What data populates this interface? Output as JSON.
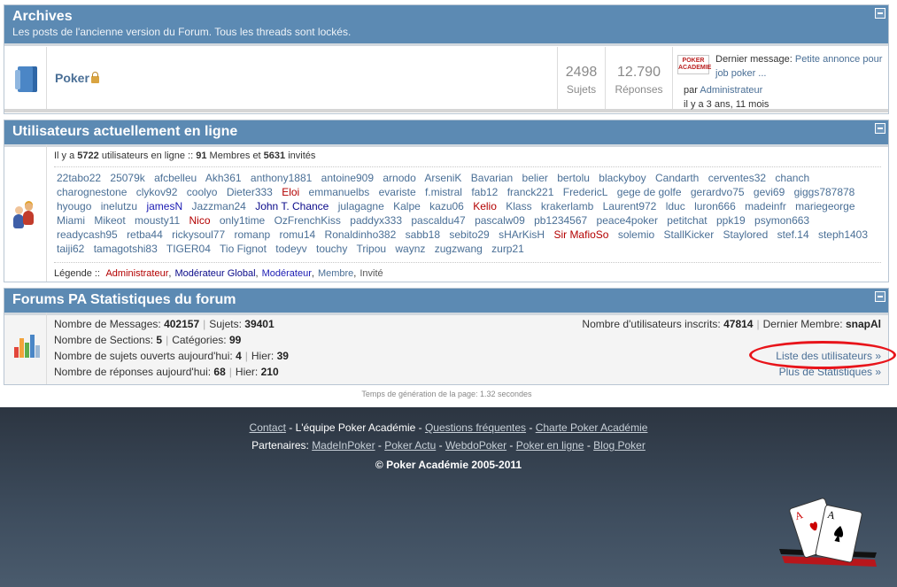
{
  "archives": {
    "title": "Archives",
    "subtitle": "Les posts de l'ancienne version du Forum. Tous les threads sont lockés.",
    "forum_name": "Poker",
    "topics_count": "2498",
    "topics_label": "Sujets",
    "replies_count": "12.790",
    "replies_label": "Réponses",
    "last_message_prefix": "Dernier message:",
    "last_message_title_1": "Petite annonce pour",
    "last_message_title_2": "job poker ...",
    "by_prefix": "par",
    "by_user": "Administrateur",
    "when": "il y a 3 ans, 11 mois",
    "logo_text": "POKER ACADEMIE"
  },
  "online": {
    "title": "Utilisateurs actuellement en ligne",
    "summary_1": "Il y a ",
    "total": "5722",
    "summary_2": " utilisateurs en ligne  ::  ",
    "members": "91",
    "summary_3": " Membres et ",
    "guests": "5631",
    "summary_4": " invités",
    "users": [
      {
        "n": "22tabo22",
        "r": "member"
      },
      {
        "n": "25079k",
        "r": "member"
      },
      {
        "n": "afcbelleu",
        "r": "member"
      },
      {
        "n": "Akh361",
        "r": "member"
      },
      {
        "n": "anthony1881",
        "r": "member"
      },
      {
        "n": "antoine909",
        "r": "member"
      },
      {
        "n": "arnodo",
        "r": "member"
      },
      {
        "n": "ArseniK",
        "r": "member"
      },
      {
        "n": "Bavarian",
        "r": "member"
      },
      {
        "n": "belier",
        "r": "member"
      },
      {
        "n": "bertolu",
        "r": "member"
      },
      {
        "n": "blackyboy",
        "r": "member"
      },
      {
        "n": "Candarth",
        "r": "member"
      },
      {
        "n": "cerventes32",
        "r": "member"
      },
      {
        "n": "chanch",
        "r": "member"
      },
      {
        "n": "charognestone",
        "r": "member"
      },
      {
        "n": "clykov92",
        "r": "member"
      },
      {
        "n": "coolyo",
        "r": "member"
      },
      {
        "n": "Dieter333",
        "r": "member"
      },
      {
        "n": "Eloi",
        "r": "admin"
      },
      {
        "n": "emmanuelbs",
        "r": "member"
      },
      {
        "n": "evariste",
        "r": "member"
      },
      {
        "n": "f.mistral",
        "r": "member"
      },
      {
        "n": "fab12",
        "r": "member"
      },
      {
        "n": "franck221",
        "r": "member"
      },
      {
        "n": "FredericL",
        "r": "member"
      },
      {
        "n": "gege de golfe",
        "r": "member"
      },
      {
        "n": "gerardvo75",
        "r": "member"
      },
      {
        "n": "gevi69",
        "r": "member"
      },
      {
        "n": "giggs787878",
        "r": "member"
      },
      {
        "n": "hyougo",
        "r": "member"
      },
      {
        "n": "inelutzu",
        "r": "member"
      },
      {
        "n": "jamesN",
        "r": "mod"
      },
      {
        "n": "Jazzman24",
        "r": "member"
      },
      {
        "n": "John T. Chance",
        "r": "modg"
      },
      {
        "n": "julagagne",
        "r": "member"
      },
      {
        "n": "Kalpe",
        "r": "member"
      },
      {
        "n": "kazu06",
        "r": "member"
      },
      {
        "n": "Kelio",
        "r": "admin"
      },
      {
        "n": "Klass",
        "r": "member"
      },
      {
        "n": "krakerlamb",
        "r": "member"
      },
      {
        "n": "Laurent972",
        "r": "member"
      },
      {
        "n": "lduc",
        "r": "member"
      },
      {
        "n": "luron666",
        "r": "member"
      },
      {
        "n": "madeinfr",
        "r": "member"
      },
      {
        "n": "mariegeorge",
        "r": "member"
      },
      {
        "n": "Miami",
        "r": "member"
      },
      {
        "n": "Mikeot",
        "r": "member"
      },
      {
        "n": "mousty11",
        "r": "member"
      },
      {
        "n": "Nico",
        "r": "admin"
      },
      {
        "n": "only1time",
        "r": "member"
      },
      {
        "n": "OzFrenchKiss",
        "r": "member"
      },
      {
        "n": "paddyx333",
        "r": "member"
      },
      {
        "n": "pascaldu47",
        "r": "member"
      },
      {
        "n": "pascalw09",
        "r": "member"
      },
      {
        "n": "pb1234567",
        "r": "member"
      },
      {
        "n": "peace4poker",
        "r": "member"
      },
      {
        "n": "petitchat",
        "r": "member"
      },
      {
        "n": "ppk19",
        "r": "member"
      },
      {
        "n": "psymon663",
        "r": "member"
      },
      {
        "n": "readycash95",
        "r": "member"
      },
      {
        "n": "retba44",
        "r": "member"
      },
      {
        "n": "rickysoul77",
        "r": "member"
      },
      {
        "n": "romanp",
        "r": "member"
      },
      {
        "n": "romu14",
        "r": "member"
      },
      {
        "n": "Ronaldinho382",
        "r": "member"
      },
      {
        "n": "sabb18",
        "r": "member"
      },
      {
        "n": "sebito29",
        "r": "member"
      },
      {
        "n": "sHArKisH",
        "r": "member"
      },
      {
        "n": "Sir MafioSo",
        "r": "admin"
      },
      {
        "n": "solemio",
        "r": "member"
      },
      {
        "n": "StallKicker",
        "r": "member"
      },
      {
        "n": "Staylored",
        "r": "member"
      },
      {
        "n": "stef.14",
        "r": "member"
      },
      {
        "n": "steph1403",
        "r": "member"
      },
      {
        "n": "taiji62",
        "r": "member"
      },
      {
        "n": "tamagotshi83",
        "r": "member"
      },
      {
        "n": "TIGER04",
        "r": "member"
      },
      {
        "n": "Tio Fignot",
        "r": "member"
      },
      {
        "n": "todeyv",
        "r": "member"
      },
      {
        "n": "touchy",
        "r": "member"
      },
      {
        "n": "Tripou",
        "r": "member"
      },
      {
        "n": "waynz",
        "r": "member"
      },
      {
        "n": "zugzwang",
        "r": "member"
      },
      {
        "n": "zurp21",
        "r": "member"
      }
    ],
    "legend_label": "Légende ::",
    "legend": [
      {
        "label": "Administrateur",
        "r": "admin"
      },
      {
        "label": "Modérateur Global",
        "r": "modg"
      },
      {
        "label": "Modérateur",
        "r": "mod"
      },
      {
        "label": "Membre",
        "r": "member"
      },
      {
        "label": "Invité",
        "r": "guest"
      }
    ]
  },
  "stats": {
    "title": "Forums PA Statistiques du forum",
    "messages_label": "Nombre de Messages:",
    "messages": "402157",
    "topics_label": "Sujets:",
    "topics": "39401",
    "sections_label": "Nombre de Sections:",
    "sections": "5",
    "categories_label": "Catégories:",
    "categories": "99",
    "open_today_label": "Nombre de sujets ouverts aujourd'hui:",
    "open_today": "4",
    "open_yesterday_label": "Hier:",
    "open_yesterday": "39",
    "replies_today_label": "Nombre de réponses aujourd'hui:",
    "replies_today": "68",
    "replies_yesterday_label": "Hier:",
    "replies_yesterday": "210",
    "registered_label": "Nombre d'utilisateurs inscrits:",
    "registered": "47814",
    "last_member_label": "Dernier Membre:",
    "last_member": "snapAl",
    "users_list_link": "Liste des utilisateurs »",
    "more_stats_link": "Plus de Statistiques »"
  },
  "generation_time": "Temps de génération de la page: 1.32 secondes",
  "footer": {
    "row1": [
      {
        "t": "Contact",
        "link": true
      },
      {
        "t": " - L'équipe Poker Académie - ",
        "link": false
      },
      {
        "t": "Questions fréquentes",
        "link": true
      },
      {
        "t": " - ",
        "link": false
      },
      {
        "t": "Charte Poker Académie",
        "link": true
      }
    ],
    "partners_label": "Partenaires: ",
    "partners": [
      "MadeInPoker",
      "Poker Actu",
      "WebdoPoker",
      "Poker en ligne",
      "Blog Poker"
    ],
    "partners_sep": " - ",
    "copyright": "© Poker Académie 2005-2011"
  },
  "colors": {
    "header_bg": "#5c8ab3",
    "link": "#4a6f96",
    "admin": "#b30000",
    "global_mod": "#0a0a8a",
    "moderator": "#1a1ab3",
    "highlight_ellipse": "#e8141a"
  },
  "icons": [
    "forum-folder-icon",
    "lock-icon",
    "users-online-icon",
    "statistics-chart-icon",
    "collapse-icon",
    "playing-cards-icon"
  ]
}
